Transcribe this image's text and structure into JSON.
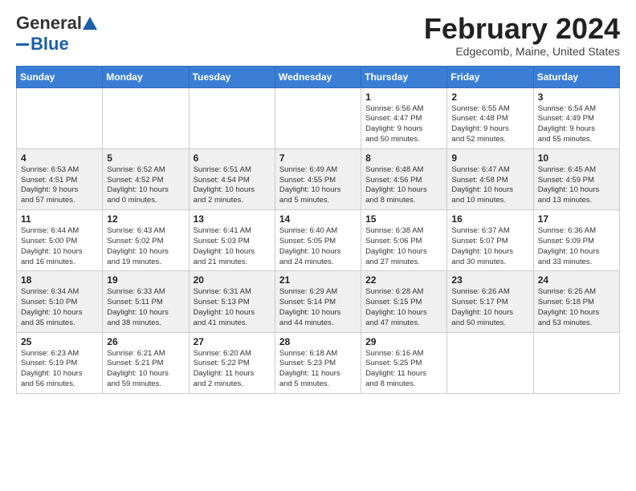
{
  "header": {
    "logo_general": "General",
    "logo_blue": "Blue",
    "month_title": "February 2024",
    "location": "Edgecomb, Maine, United States"
  },
  "weekdays": [
    "Sunday",
    "Monday",
    "Tuesday",
    "Wednesday",
    "Thursday",
    "Friday",
    "Saturday"
  ],
  "weeks": [
    [
      {
        "day": "",
        "info": ""
      },
      {
        "day": "",
        "info": ""
      },
      {
        "day": "",
        "info": ""
      },
      {
        "day": "",
        "info": ""
      },
      {
        "day": "1",
        "info": "Sunrise: 6:56 AM\nSunset: 4:47 PM\nDaylight: 9 hours\nand 50 minutes."
      },
      {
        "day": "2",
        "info": "Sunrise: 6:55 AM\nSunset: 4:48 PM\nDaylight: 9 hours\nand 52 minutes."
      },
      {
        "day": "3",
        "info": "Sunrise: 6:54 AM\nSunset: 4:49 PM\nDaylight: 9 hours\nand 55 minutes."
      }
    ],
    [
      {
        "day": "4",
        "info": "Sunrise: 6:53 AM\nSunset: 4:51 PM\nDaylight: 9 hours\nand 57 minutes."
      },
      {
        "day": "5",
        "info": "Sunrise: 6:52 AM\nSunset: 4:52 PM\nDaylight: 10 hours\nand 0 minutes."
      },
      {
        "day": "6",
        "info": "Sunrise: 6:51 AM\nSunset: 4:54 PM\nDaylight: 10 hours\nand 2 minutes."
      },
      {
        "day": "7",
        "info": "Sunrise: 6:49 AM\nSunset: 4:55 PM\nDaylight: 10 hours\nand 5 minutes."
      },
      {
        "day": "8",
        "info": "Sunrise: 6:48 AM\nSunset: 4:56 PM\nDaylight: 10 hours\nand 8 minutes."
      },
      {
        "day": "9",
        "info": "Sunrise: 6:47 AM\nSunset: 4:58 PM\nDaylight: 10 hours\nand 10 minutes."
      },
      {
        "day": "10",
        "info": "Sunrise: 6:45 AM\nSunset: 4:59 PM\nDaylight: 10 hours\nand 13 minutes."
      }
    ],
    [
      {
        "day": "11",
        "info": "Sunrise: 6:44 AM\nSunset: 5:00 PM\nDaylight: 10 hours\nand 16 minutes."
      },
      {
        "day": "12",
        "info": "Sunrise: 6:43 AM\nSunset: 5:02 PM\nDaylight: 10 hours\nand 19 minutes."
      },
      {
        "day": "13",
        "info": "Sunrise: 6:41 AM\nSunset: 5:03 PM\nDaylight: 10 hours\nand 21 minutes."
      },
      {
        "day": "14",
        "info": "Sunrise: 6:40 AM\nSunset: 5:05 PM\nDaylight: 10 hours\nand 24 minutes."
      },
      {
        "day": "15",
        "info": "Sunrise: 6:38 AM\nSunset: 5:06 PM\nDaylight: 10 hours\nand 27 minutes."
      },
      {
        "day": "16",
        "info": "Sunrise: 6:37 AM\nSunset: 5:07 PM\nDaylight: 10 hours\nand 30 minutes."
      },
      {
        "day": "17",
        "info": "Sunrise: 6:36 AM\nSunset: 5:09 PM\nDaylight: 10 hours\nand 33 minutes."
      }
    ],
    [
      {
        "day": "18",
        "info": "Sunrise: 6:34 AM\nSunset: 5:10 PM\nDaylight: 10 hours\nand 35 minutes."
      },
      {
        "day": "19",
        "info": "Sunrise: 6:33 AM\nSunset: 5:11 PM\nDaylight: 10 hours\nand 38 minutes."
      },
      {
        "day": "20",
        "info": "Sunrise: 6:31 AM\nSunset: 5:13 PM\nDaylight: 10 hours\nand 41 minutes."
      },
      {
        "day": "21",
        "info": "Sunrise: 6:29 AM\nSunset: 5:14 PM\nDaylight: 10 hours\nand 44 minutes."
      },
      {
        "day": "22",
        "info": "Sunrise: 6:28 AM\nSunset: 5:15 PM\nDaylight: 10 hours\nand 47 minutes."
      },
      {
        "day": "23",
        "info": "Sunrise: 6:26 AM\nSunset: 5:17 PM\nDaylight: 10 hours\nand 50 minutes."
      },
      {
        "day": "24",
        "info": "Sunrise: 6:25 AM\nSunset: 5:18 PM\nDaylight: 10 hours\nand 53 minutes."
      }
    ],
    [
      {
        "day": "25",
        "info": "Sunrise: 6:23 AM\nSunset: 5:19 PM\nDaylight: 10 hours\nand 56 minutes."
      },
      {
        "day": "26",
        "info": "Sunrise: 6:21 AM\nSunset: 5:21 PM\nDaylight: 10 hours\nand 59 minutes."
      },
      {
        "day": "27",
        "info": "Sunrise: 6:20 AM\nSunset: 5:22 PM\nDaylight: 11 hours\nand 2 minutes."
      },
      {
        "day": "28",
        "info": "Sunrise: 6:18 AM\nSunset: 5:23 PM\nDaylight: 11 hours\nand 5 minutes."
      },
      {
        "day": "29",
        "info": "Sunrise: 6:16 AM\nSunset: 5:25 PM\nDaylight: 11 hours\nand 8 minutes."
      },
      {
        "day": "",
        "info": ""
      },
      {
        "day": "",
        "info": ""
      }
    ]
  ]
}
